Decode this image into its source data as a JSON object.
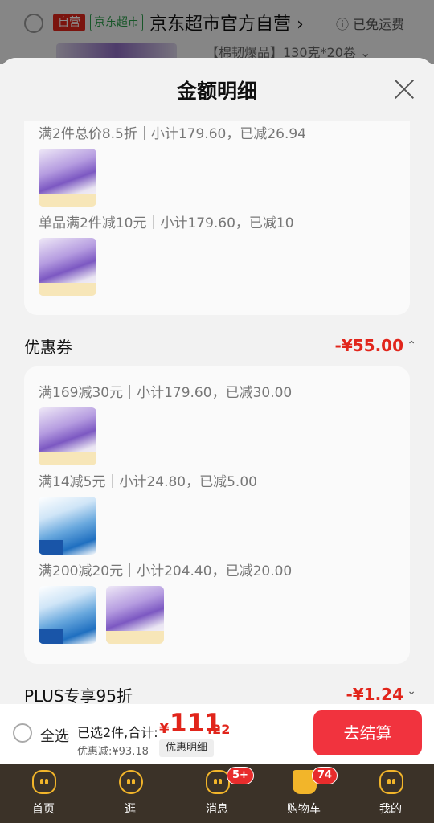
{
  "background": {
    "self_operated": "自营",
    "supermarket_tag": "京东超市",
    "store_name": "京东超市官方自营",
    "store_chevron": "›",
    "free_shipping": "ⓘ 已免运费",
    "product_spec": "【棉韧爆品】130克*20卷 ⌄"
  },
  "sheet": {
    "title": "金额明细",
    "card1": {
      "rules": [
        "满2件总价8.5折｜小计179.60，已减26.94",
        "单品满2件减10元｜小计179.60，已减10"
      ]
    },
    "coupon": {
      "title": "优惠券",
      "amount": "-¥55.00",
      "chevron": "⌃",
      "rules": [
        "满169减30元｜小计179.60，已减30.00",
        "满14减5元｜小计24.80，已减5.00",
        "满200减20元｜小计204.40，已减20.00"
      ]
    },
    "plus": {
      "title": "PLUS专享95折",
      "amount": "-¥1.24",
      "chevron": "⌄"
    }
  },
  "bottom_bar": {
    "select_all": "全选",
    "selected_total_label": "已选2件,合计:",
    "currency": "¥",
    "total_int": "111",
    "total_dec": ".22",
    "discount": "优惠减:¥93.18",
    "detail_button": "优惠明细",
    "checkout_button": "去结算"
  },
  "tabbar": {
    "tabs": [
      {
        "label": "首页",
        "icon": "home-icon"
      },
      {
        "label": "逛",
        "icon": "browse-icon"
      },
      {
        "label": "消息",
        "icon": "message-icon",
        "badge": "5+"
      },
      {
        "label": "购物车",
        "icon": "cart-icon",
        "badge": "74"
      },
      {
        "label": "我的",
        "icon": "profile-icon"
      }
    ]
  },
  "colors": {
    "accent": "#e1251b",
    "checkout": "#f1333e",
    "tabbar_bg": "#3b3228",
    "tab_icon": "#f2b52a"
  }
}
